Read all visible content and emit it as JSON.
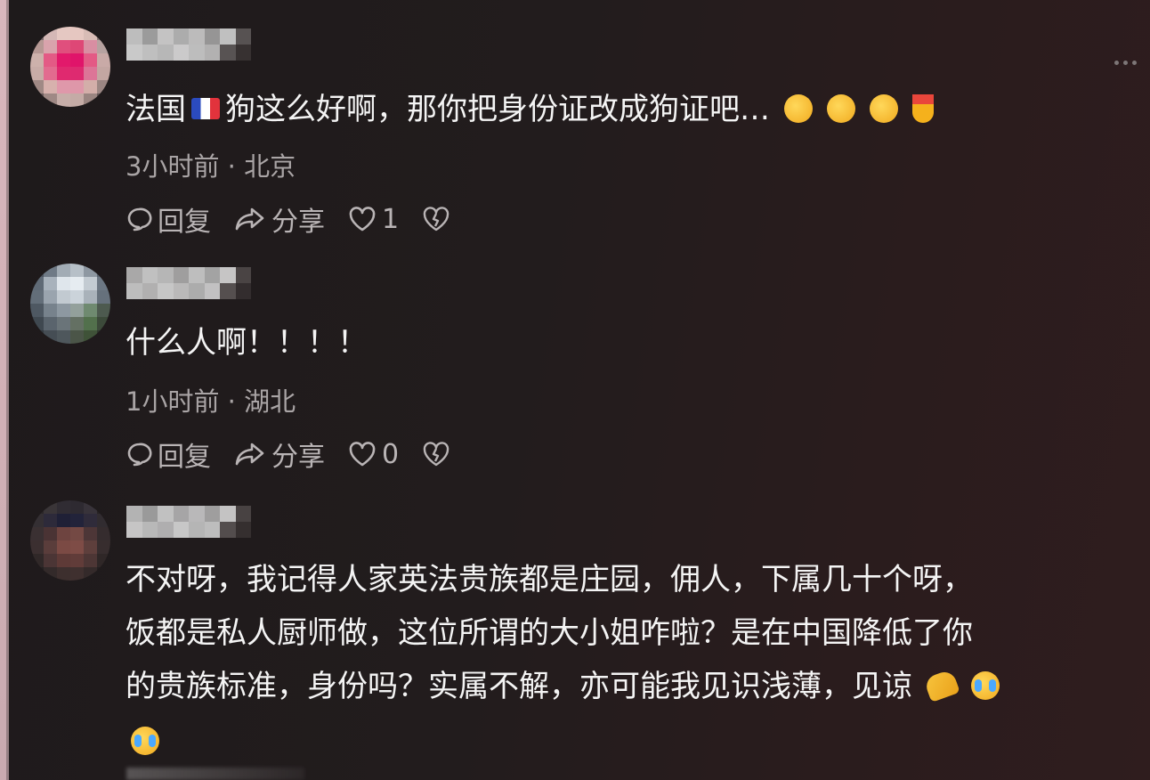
{
  "comments": [
    {
      "text_before_flag": "法国",
      "text_after_flag": "狗这么好啊，那你把身份证改成狗证吧…",
      "emojis": [
        "thinking-emoji",
        "thinking-emoji",
        "thinking-emoji",
        "medal-emoji"
      ],
      "meta": "3小时前 · 北京",
      "reply_label": "回复",
      "share_label": "分享",
      "like_count": "1"
    },
    {
      "text": "什么人啊！！！！",
      "meta": "1小时前 · 湖北",
      "reply_label": "回复",
      "share_label": "分享",
      "like_count": "0"
    },
    {
      "lines": [
        "不对呀，我记得人家英法贵族都是庄园，佣人，下属几十个呀，",
        "饭都是私人厨师做，这位所谓的大小姐咋啦？是在中国降低了你",
        "的贵族标准，身份吗？实属不解，亦可能我见识浅薄，见谅"
      ],
      "emojis": [
        "praying-hands-emoji",
        "crying-laughing-emoji",
        "crying-laughing-emoji"
      ]
    }
  ],
  "colors": {
    "background": "#221c1d",
    "text": "#f4f4f4",
    "meta": "#a9a4a5",
    "actions": "#b9b4b5"
  }
}
